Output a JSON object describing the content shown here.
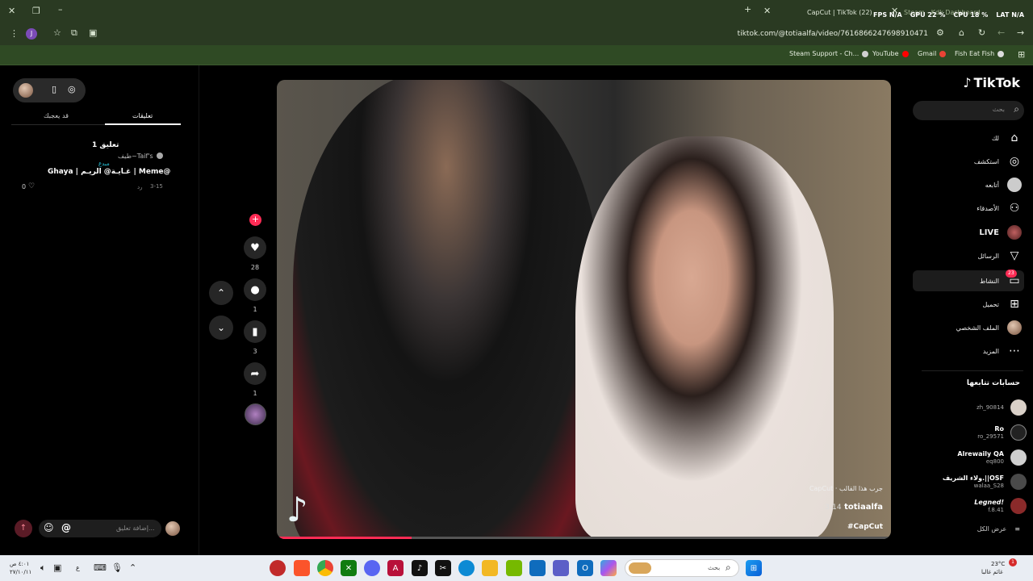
{
  "browser": {
    "tabs": [
      {
        "label": "CapCut | TikTok (22)"
      },
      {
        "label": "Steam - Kdk Dashboard"
      }
    ],
    "overlay": {
      "fps": "FPS N/A",
      "gpu": "GPU 22 %",
      "cpu": "CPU 18 %",
      "lat": "LAT N/A"
    },
    "url": "tiktok.com/@totiaalfa/video/7616866247698910471",
    "profile_initial": "J",
    "bookmarks": [
      {
        "label": "Steam Support - Ch...",
        "color": "#1b2838"
      },
      {
        "label": "YouTube",
        "color": "#ff0000"
      },
      {
        "label": "Gmail",
        "color": "#ea4335"
      },
      {
        "label": "Fish Eat Fish",
        "color": "#4a90d9"
      }
    ]
  },
  "comments_panel": {
    "tab_comments": "تعليقات",
    "tab_you_may_like": "قد يعجبك",
    "count": "1 تعليق",
    "comment": {
      "author": "طيف~Taif's",
      "badge": "مبدع",
      "text": "Ghaya | غـايـة@ الريـم | Meme@",
      "date": "3-15",
      "reply": "رد",
      "likes": "0"
    },
    "input_placeholder": "إضافة تعليق...",
    "at_symbol": "@"
  },
  "actions": {
    "likes": "28",
    "comments": "1",
    "saves": "3",
    "shares": "1"
  },
  "video": {
    "template_label": "CapCut · جرب هذا القالب",
    "username": "totiaalfa",
    "date": "3-14",
    "hashtag": "#CapCut",
    "progress": 0.22
  },
  "sidebar": {
    "logo": "TikTok",
    "search_placeholder": "بحث",
    "nav": [
      {
        "label": "لك",
        "icon": "⌂"
      },
      {
        "label": "استكشف",
        "icon": "◎"
      },
      {
        "label": "أتابعه",
        "icon": "●"
      },
      {
        "label": "الأصدقاء",
        "icon": "⚇"
      },
      {
        "label": "LIVE",
        "icon": "●"
      },
      {
        "label": "الرسائل",
        "icon": "▽"
      },
      {
        "label": "النشاط",
        "icon": "▭",
        "badge": "23"
      },
      {
        "label": "تحميل",
        "icon": "⊞"
      },
      {
        "label": "الملف الشخصي",
        "icon": "●"
      },
      {
        "label": "المزيد",
        "icon": "⋯"
      }
    ],
    "following_title": "حسابات تتابعها",
    "following": [
      {
        "name": "",
        "handle": "zh_90814",
        "color": "#d9d0c8"
      },
      {
        "name": "Ro",
        "handle": "ro_29571",
        "color": "#222"
      },
      {
        "name": "Alrewaily QA",
        "handle": "eq800",
        "color": "#cfcfcf"
      },
      {
        "name": "ولاء الشريف.||OSF",
        "handle": "walaa_S28",
        "color": "#4a4a4a"
      },
      {
        "name": "Legned!",
        "handle": "f.8.41",
        "color": "#8a2a2a"
      }
    ],
    "show_all": "عرض الكل"
  },
  "taskbar": {
    "search_placeholder": "بحث",
    "weather_temp": "23°C",
    "weather_text": "غائم غالبا",
    "time": "٤:٠١ ص",
    "date": "٢٧/١٠/١١",
    "lang": "ع"
  }
}
